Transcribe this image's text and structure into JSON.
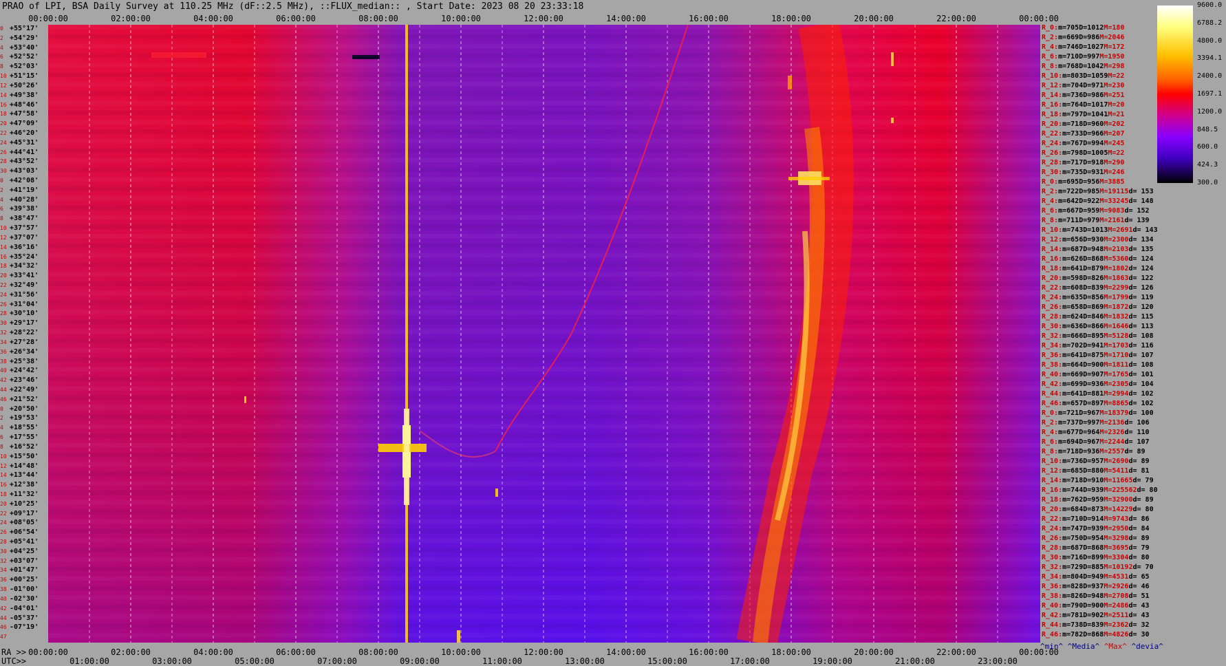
{
  "chart_data": {
    "type": "heatmap",
    "title": "PRAO of LPI, BSA Daily Survey at 110.25 MHz (dF::2.5 MHz), ::FLUX_median:: , Start Date: 2023 08 20 23:33:18",
    "x_top_ticks": [
      "00:00:00",
      "02:00:00",
      "04:00:00",
      "06:00:00",
      "08:00:00",
      "10:00:00",
      "12:00:00",
      "14:00:00",
      "16:00:00",
      "18:00:00",
      "20:00:00",
      "22:00:00",
      "00:00:00"
    ],
    "x_bottom_ra_ticks": [
      "00:00:00",
      "02:00:00",
      "04:00:00",
      "06:00:00",
      "08:00:00",
      "10:00:00",
      "12:00:00",
      "14:00:00",
      "16:00:00",
      "18:00:00",
      "20:00:00",
      "22:00:00",
      "00:00:00"
    ],
    "x_bottom_utc_ticks": [
      "01:00:00",
      "03:00:00",
      "05:00:00",
      "07:00:00",
      "09:00:00",
      "11:00:00",
      "13:00:00",
      "15:00:00",
      "17:00:00",
      "19:00:00",
      "21:00:00",
      "23:00:00"
    ],
    "ra_label": "RA >>",
    "utc_label": "UTC>>",
    "colorbar_ticks": [
      "9600.0",
      "6788.2",
      "4800.0",
      "3394.1",
      "2400.0",
      "1697.1",
      "1200.0",
      "848.5",
      "600.0",
      "424.3",
      "300.0"
    ],
    "declinations": [
      {
        "row": "0",
        "dec": "+55°17'"
      },
      {
        "row": "2",
        "dec": "+54°29'"
      },
      {
        "row": "4",
        "dec": "+53°40'"
      },
      {
        "row": "6",
        "dec": "+52°52'"
      },
      {
        "row": "8",
        "dec": "+52°03'"
      },
      {
        "row": "10",
        "dec": "+51°15'"
      },
      {
        "row": "12",
        "dec": "+50°26'"
      },
      {
        "row": "14",
        "dec": "+49°38'"
      },
      {
        "row": "16",
        "dec": "+48°46'"
      },
      {
        "row": "18",
        "dec": "+47°58'"
      },
      {
        "row": "20",
        "dec": "+47°09'"
      },
      {
        "row": "22",
        "dec": "+46°20'"
      },
      {
        "row": "24",
        "dec": "+45°31'"
      },
      {
        "row": "26",
        "dec": "+44°41'"
      },
      {
        "row": "28",
        "dec": "+43°52'"
      },
      {
        "row": "30",
        "dec": "+43°03'"
      },
      {
        "row": "0",
        "dec": "+42°08'"
      },
      {
        "row": "2",
        "dec": "+41°19'"
      },
      {
        "row": "4",
        "dec": "+40°28'"
      },
      {
        "row": "6",
        "dec": "+39°38'"
      },
      {
        "row": "8",
        "dec": "+38°47'"
      },
      {
        "row": "10",
        "dec": "+37°57'"
      },
      {
        "row": "12",
        "dec": "+37°07'"
      },
      {
        "row": "14",
        "dec": "+36°16'"
      },
      {
        "row": "16",
        "dec": "+35°24'"
      },
      {
        "row": "18",
        "dec": "+34°32'"
      },
      {
        "row": "20",
        "dec": "+33°41'"
      },
      {
        "row": "22",
        "dec": "+32°49'"
      },
      {
        "row": "24",
        "dec": "+31°56'"
      },
      {
        "row": "26",
        "dec": "+31°04'"
      },
      {
        "row": "28",
        "dec": "+30°10'"
      },
      {
        "row": "30",
        "dec": "+29°17'"
      },
      {
        "row": "32",
        "dec": "+28°22'"
      },
      {
        "row": "34",
        "dec": "+27°28'"
      },
      {
        "row": "36",
        "dec": "+26°34'"
      },
      {
        "row": "38",
        "dec": "+25°38'"
      },
      {
        "row": "40",
        "dec": "+24°42'"
      },
      {
        "row": "42",
        "dec": "+23°46'"
      },
      {
        "row": "44",
        "dec": "+22°49'"
      },
      {
        "row": "46",
        "dec": "+21°52'"
      },
      {
        "row": "0",
        "dec": "+20°50'"
      },
      {
        "row": "2",
        "dec": "+19°53'"
      },
      {
        "row": "4",
        "dec": "+18°55'"
      },
      {
        "row": "6",
        "dec": "+17°55'"
      },
      {
        "row": "8",
        "dec": "+16°52'"
      },
      {
        "row": "10",
        "dec": "+15°50'"
      },
      {
        "row": "12",
        "dec": "+14°48'"
      },
      {
        "row": "14",
        "dec": "+13°44'"
      },
      {
        "row": "16",
        "dec": "+12°38'"
      },
      {
        "row": "18",
        "dec": "+11°32'"
      },
      {
        "row": "20",
        "dec": "+10°25'"
      },
      {
        "row": "22",
        "dec": "+09°17'"
      },
      {
        "row": "24",
        "dec": "+08°05'"
      },
      {
        "row": "26",
        "dec": "+06°54'"
      },
      {
        "row": "28",
        "dec": "+05°41'"
      },
      {
        "row": "30",
        "dec": "+04°25'"
      },
      {
        "row": "32",
        "dec": "+03°07'"
      },
      {
        "row": "34",
        "dec": "+01°47'"
      },
      {
        "row": "36",
        "dec": "+00°25'"
      },
      {
        "row": "38",
        "dec": "-01°00'"
      },
      {
        "row": "40",
        "dec": "-02°30'"
      },
      {
        "row": "42",
        "dec": "-04°01'"
      },
      {
        "row": "44",
        "dec": "-05°37'"
      },
      {
        "row": "46",
        "dec": "-07°19'"
      },
      {
        "row": "47",
        "dec": ""
      }
    ],
    "stats_rows": [
      {
        "r": "R_0:",
        "min": "m=705",
        "med": "D=1012",
        "max": "M=180",
        "dev": ""
      },
      {
        "r": "R_2:",
        "min": "m=669",
        "med": "D=986",
        "max": "M=2046",
        "dev": ""
      },
      {
        "r": "R_4:",
        "min": "m=746",
        "med": "D=1027",
        "max": "M=172",
        "dev": ""
      },
      {
        "r": "R_6:",
        "min": "m=710",
        "med": "D=997",
        "max": "M=1950",
        "dev": ""
      },
      {
        "r": "R_8:",
        "min": "m=768",
        "med": "D=1042",
        "max": "M=298",
        "dev": ""
      },
      {
        "r": "R_10:",
        "min": "m=803",
        "med": "D=1059",
        "max": "M=22",
        "dev": ""
      },
      {
        "r": "R_12:",
        "min": "m=704",
        "med": "D=971",
        "max": "M=230",
        "dev": ""
      },
      {
        "r": "R_14:",
        "min": "m=736",
        "med": "D=986",
        "max": "M=251",
        "dev": ""
      },
      {
        "r": "R_16:",
        "min": "m=764",
        "med": "D=1017",
        "max": "M=20",
        "dev": ""
      },
      {
        "r": "R_18:",
        "min": "m=797",
        "med": "D=1041",
        "max": "M=21",
        "dev": ""
      },
      {
        "r": "R_20:",
        "min": "m=718",
        "med": "D=960",
        "max": "M=202",
        "dev": ""
      },
      {
        "r": "R_22:",
        "min": "m=733",
        "med": "D=966",
        "max": "M=207",
        "dev": ""
      },
      {
        "r": "R_24:",
        "min": "m=767",
        "med": "D=994",
        "max": "M=245",
        "dev": ""
      },
      {
        "r": "R_26:",
        "min": "m=798",
        "med": "D=1005",
        "max": "M=22",
        "dev": ""
      },
      {
        "r": "R_28:",
        "min": "m=717",
        "med": "D=918",
        "max": "M=290",
        "dev": ""
      },
      {
        "r": "R_30:",
        "min": "m=735",
        "med": "D=931",
        "max": "M=246",
        "dev": ""
      },
      {
        "r": "R_0:",
        "min": "m=695",
        "med": "D=956",
        "max": "M=3885",
        "dev": ""
      },
      {
        "r": "R_2:",
        "min": "m=722",
        "med": "D=985",
        "max": "M=19115",
        "dev": "d= 153"
      },
      {
        "r": "R_4:",
        "min": "m=642",
        "med": "D=922",
        "max": "M=33245",
        "dev": "d= 148"
      },
      {
        "r": "R_6:",
        "min": "m=667",
        "med": "D=959",
        "max": "M=9083",
        "dev": "d= 152"
      },
      {
        "r": "R_8:",
        "min": "m=711",
        "med": "D=979",
        "max": "M=2161",
        "dev": "d= 139"
      },
      {
        "r": "R_10:",
        "min": "m=743",
        "med": "D=1013",
        "max": "M=2691",
        "dev": "d= 143"
      },
      {
        "r": "R_12:",
        "min": "m=656",
        "med": "D=930",
        "max": "M=2300",
        "dev": "d= 134"
      },
      {
        "r": "R_14:",
        "min": "m=687",
        "med": "D=948",
        "max": "M=2103",
        "dev": "d= 135"
      },
      {
        "r": "R_16:",
        "min": "m=626",
        "med": "D=868",
        "max": "M=5360",
        "dev": "d= 124"
      },
      {
        "r": "R_18:",
        "min": "m=641",
        "med": "D=879",
        "max": "M=1802",
        "dev": "d= 124"
      },
      {
        "r": "R_20:",
        "min": "m=598",
        "med": "D=826",
        "max": "M=1863",
        "dev": "d= 122"
      },
      {
        "r": "R_22:",
        "min": "m=608",
        "med": "D=839",
        "max": "M=2299",
        "dev": "d= 126"
      },
      {
        "r": "R_24:",
        "min": "m=635",
        "med": "D=856",
        "max": "M=1799",
        "dev": "d= 119"
      },
      {
        "r": "R_26:",
        "min": "m=658",
        "med": "D=869",
        "max": "M=1872",
        "dev": "d= 120"
      },
      {
        "r": "R_28:",
        "min": "m=624",
        "med": "D=846",
        "max": "M=1832",
        "dev": "d= 115"
      },
      {
        "r": "R_30:",
        "min": "m=636",
        "med": "D=866",
        "max": "M=1646",
        "dev": "d= 113"
      },
      {
        "r": "R_32:",
        "min": "m=666",
        "med": "D=895",
        "max": "M=5128",
        "dev": "d= 108"
      },
      {
        "r": "R_34:",
        "min": "m=702",
        "med": "D=941",
        "max": "M=1703",
        "dev": "d= 116"
      },
      {
        "r": "R_36:",
        "min": "m=641",
        "med": "D=875",
        "max": "M=1710",
        "dev": "d= 107"
      },
      {
        "r": "R_38:",
        "min": "m=664",
        "med": "D=900",
        "max": "M=1811",
        "dev": "d= 108"
      },
      {
        "r": "R_40:",
        "min": "m=669",
        "med": "D=907",
        "max": "M=1765",
        "dev": "d= 101"
      },
      {
        "r": "R_42:",
        "min": "m=699",
        "med": "D=936",
        "max": "M=2305",
        "dev": "d= 104"
      },
      {
        "r": "R_44:",
        "min": "m=641",
        "med": "D=881",
        "max": "M=2994",
        "dev": "d= 102"
      },
      {
        "r": "R_46:",
        "min": "m=657",
        "med": "D=897",
        "max": "M=8865",
        "dev": "d= 102"
      },
      {
        "r": "R_0:",
        "min": "m=721",
        "med": "D=967",
        "max": "M=18379",
        "dev": "d= 100"
      },
      {
        "r": "R_2:",
        "min": "m=737",
        "med": "D=997",
        "max": "M=2136",
        "dev": "d= 106"
      },
      {
        "r": "R_4:",
        "min": "m=677",
        "med": "D=964",
        "max": "M=2326",
        "dev": "d= 110"
      },
      {
        "r": "R_6:",
        "min": "m=694",
        "med": "D=967",
        "max": "M=2244",
        "dev": "d= 107"
      },
      {
        "r": "R_8:",
        "min": "m=718",
        "med": "D=936",
        "max": "M=2557",
        "dev": "d= 89"
      },
      {
        "r": "R_10:",
        "min": "m=736",
        "med": "D=957",
        "max": "M=2690",
        "dev": "d= 89"
      },
      {
        "r": "R_12:",
        "min": "m=685",
        "med": "D=880",
        "max": "M=5411",
        "dev": "d= 81"
      },
      {
        "r": "R_14:",
        "min": "m=718",
        "med": "D=910",
        "max": "M=11665",
        "dev": "d= 79"
      },
      {
        "r": "R_16:",
        "min": "m=744",
        "med": "D=939",
        "max": "M=225562",
        "dev": "d= 80"
      },
      {
        "r": "R_18:",
        "min": "m=762",
        "med": "D=959",
        "max": "M=32900",
        "dev": "d= 89"
      },
      {
        "r": "R_20:",
        "min": "m=684",
        "med": "D=873",
        "max": "M=14229",
        "dev": "d= 80"
      },
      {
        "r": "R_22:",
        "min": "m=710",
        "med": "D=914",
        "max": "M=9743",
        "dev": "d= 86"
      },
      {
        "r": "R_24:",
        "min": "m=747",
        "med": "D=939",
        "max": "M=2950",
        "dev": "d= 84"
      },
      {
        "r": "R_26:",
        "min": "m=750",
        "med": "D=954",
        "max": "M=3298",
        "dev": "d= 89"
      },
      {
        "r": "R_28:",
        "min": "m=687",
        "med": "D=868",
        "max": "M=3695",
        "dev": "d= 79"
      },
      {
        "r": "R_30:",
        "min": "m=716",
        "med": "D=899",
        "max": "M=3304",
        "dev": "d= 80"
      },
      {
        "r": "R_32:",
        "min": "m=729",
        "med": "D=885",
        "max": "M=10192",
        "dev": "d= 70"
      },
      {
        "r": "R_34:",
        "min": "m=804",
        "med": "D=949",
        "max": "M=4531",
        "dev": "d= 65"
      },
      {
        "r": "R_36:",
        "min": "m=828",
        "med": "D=937",
        "max": "M=2926",
        "dev": "d= 46"
      },
      {
        "r": "R_38:",
        "min": "m=826",
        "med": "D=948",
        "max": "M=2708",
        "dev": "d= 51"
      },
      {
        "r": "R_40:",
        "min": "m=790",
        "med": "D=900",
        "max": "M=2486",
        "dev": "d= 43"
      },
      {
        "r": "R_42:",
        "min": "m=781",
        "med": "D=902",
        "max": "M=2511",
        "dev": "d= 43"
      },
      {
        "r": "R_44:",
        "min": "m=738",
        "med": "D=839",
        "max": "M=2362",
        "dev": "d= 32"
      },
      {
        "r": "R_46:",
        "min": "m=782",
        "med": "D=868",
        "max": "M=4826",
        "dev": "d= 30"
      }
    ],
    "legend": {
      "min": "^min^",
      "med": "^Media^",
      "max": "^Max^",
      "dev": "^devia^"
    },
    "colors": {
      "low": "#1a0040",
      "mid": "#6a1aff",
      "high": "#ff1010",
      "peak": "#ffffc0",
      "background": "#a6a6a6",
      "accent_red": "#cc0000"
    }
  }
}
